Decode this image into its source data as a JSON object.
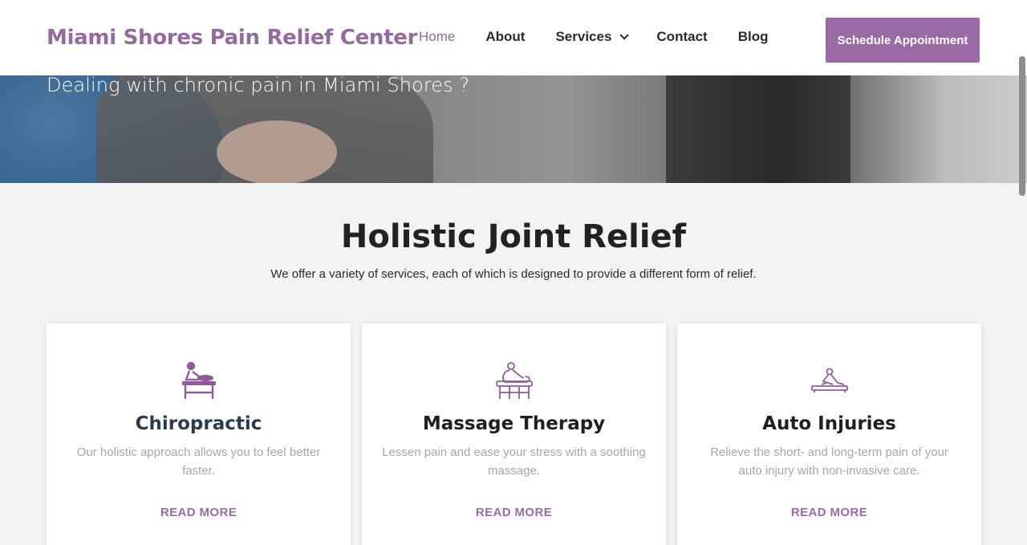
{
  "hero": {
    "subtitle": "Dealing with chronic pain in Miami Shores ?"
  },
  "header": {
    "brand": "Miami Shores Pain Relief Center",
    "nav": [
      {
        "label": "Home",
        "active": true
      },
      {
        "label": "About"
      },
      {
        "label": "Services",
        "has_dropdown": true
      },
      {
        "label": "Contact"
      },
      {
        "label": "Blog"
      }
    ],
    "cta_label": "Schedule Appointment"
  },
  "section": {
    "title": "Holistic Joint Relief",
    "subtitle": "We offer a variety of services, each of which is designed to provide a different form of relief."
  },
  "cards": [
    {
      "icon": "chiropractic-icon",
      "title": "Chiropractic",
      "description": "Our holistic approach allows you to feel better faster.",
      "link": "READ MORE"
    },
    {
      "icon": "massage-therapy-icon",
      "title": "Massage Therapy",
      "description": "Lessen pain and ease your stress with a soothing massage.",
      "link": "READ MORE"
    },
    {
      "icon": "auto-injury-icon",
      "title": "Auto Injuries",
      "description": "Relieve the short- and long-term pain of your auto injury with non-invasive care.",
      "link": "READ MORE"
    }
  ],
  "colors": {
    "brand": "#956a9f",
    "cta_background": "#9b6aa6",
    "text_dark": "#222222",
    "text_muted": "#a7a7a7",
    "page_background": "#f3f3f3"
  }
}
